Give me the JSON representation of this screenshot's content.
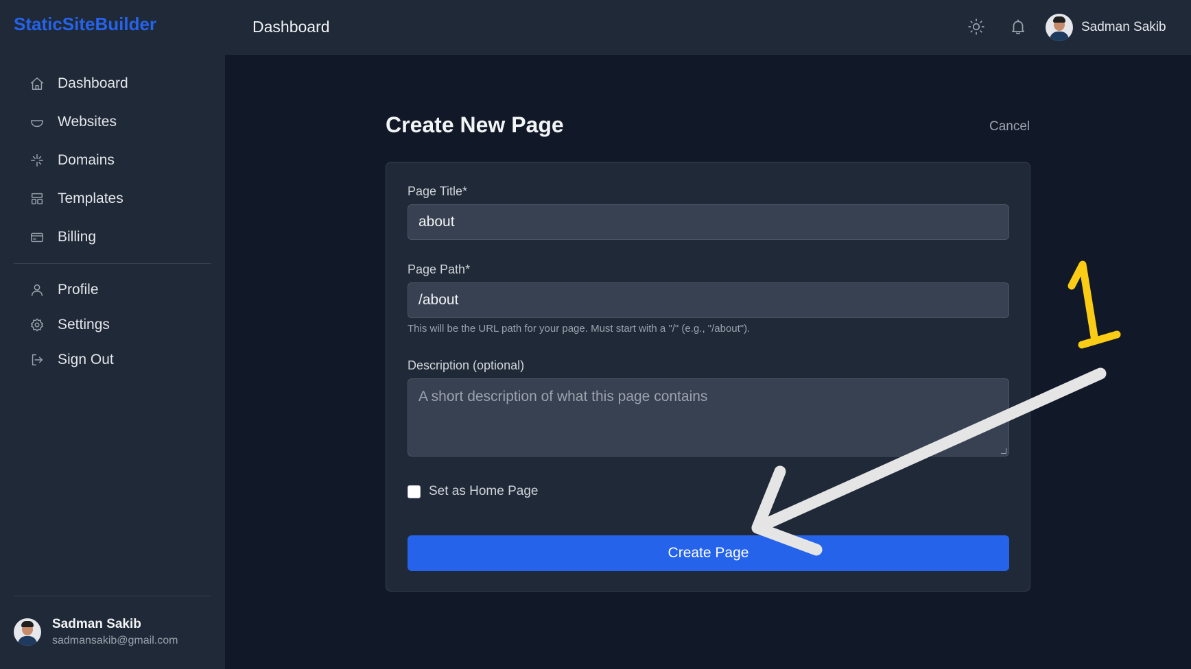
{
  "brand": "StaticSiteBuilder",
  "sidebar": {
    "items": [
      {
        "label": "Dashboard",
        "icon": "home-icon"
      },
      {
        "label": "Websites",
        "icon": "bowl-icon"
      },
      {
        "label": "Domains",
        "icon": "sparkle-icon"
      },
      {
        "label": "Templates",
        "icon": "template-icon"
      },
      {
        "label": "Billing",
        "icon": "credit-card-icon"
      }
    ],
    "secondary": [
      {
        "label": "Profile",
        "icon": "user-icon"
      },
      {
        "label": "Settings",
        "icon": "gear-icon"
      },
      {
        "label": "Sign Out",
        "icon": "sign-out-icon"
      }
    ],
    "user": {
      "name": "Sadman Sakib",
      "email": "sadmansakib@gmail.com"
    }
  },
  "topbar": {
    "title": "Dashboard",
    "user_name": "Sadman Sakib",
    "icons": [
      "sun-icon",
      "bell-icon"
    ]
  },
  "main": {
    "heading": "Create New Page",
    "cancel_label": "Cancel",
    "form": {
      "title_label": "Page Title*",
      "title_value": "about",
      "path_label": "Page Path*",
      "path_value": "/about",
      "path_help": "This will be the URL path for your page. Must start with a \"/\" (e.g., \"/about\").",
      "description_label": "Description (optional)",
      "description_placeholder": "A short description of what this page contains",
      "home_checkbox_label": "Set as Home Page",
      "home_checkbox_checked": false,
      "submit_label": "Create Page"
    }
  },
  "annotation": {
    "step_number": "1",
    "arrow_color": "#e5e5e5",
    "number_color": "#facc15"
  },
  "colors": {
    "accent": "#2563eb",
    "background": "#111827",
    "panel": "#1f2937"
  }
}
